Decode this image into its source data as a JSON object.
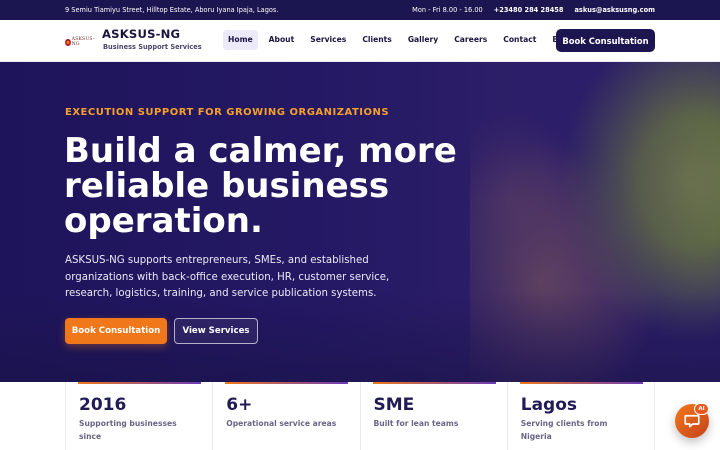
{
  "topbar": {
    "address": "9 Semiu Tiamiyu Street, Hilltop Estate, Aboru Iyana Ipaja, Lagos.",
    "hours": "Mon - Fri 8.00 - 16.00",
    "phone": "+23480 284 28458",
    "email": "askus@asksusng.com"
  },
  "brand": {
    "logo_text": "ASKSUS-NG",
    "name": "ASKSUS-NG",
    "tagline": "Business Support Services"
  },
  "nav": {
    "items": [
      {
        "label": "Home",
        "active": true
      },
      {
        "label": "About"
      },
      {
        "label": "Services"
      },
      {
        "label": "Clients"
      },
      {
        "label": "Gallery"
      },
      {
        "label": "Careers"
      },
      {
        "label": "Contact"
      },
      {
        "label": "Blog"
      }
    ],
    "cta_label": "Book Consultation"
  },
  "hero": {
    "eyebrow": "EXECUTION SUPPORT FOR GROWING ORGANIZATIONS",
    "headline": "Build a calmer, more reliable business operation.",
    "lede": "ASKSUS-NG supports entrepreneurs, SMEs, and established organizations with back-office execution, HR, customer service, research, logistics, training, and service publication systems.",
    "primary_cta": "Book Consultation",
    "secondary_cta": "View Services"
  },
  "stats": [
    {
      "value": "2016",
      "label": "Supporting businesses since"
    },
    {
      "value": "6+",
      "label": "Operational service areas"
    },
    {
      "value": "SME",
      "label": "Built for lean teams"
    },
    {
      "value": "Lagos",
      "label": "Serving clients from Nigeria"
    }
  ],
  "chat_widget": {
    "icon": "chat-bubble-icon",
    "badge": "AI"
  },
  "colors": {
    "primary": "#1c1650",
    "accent": "#f0781a",
    "eyebrow": "#f59f2c"
  }
}
